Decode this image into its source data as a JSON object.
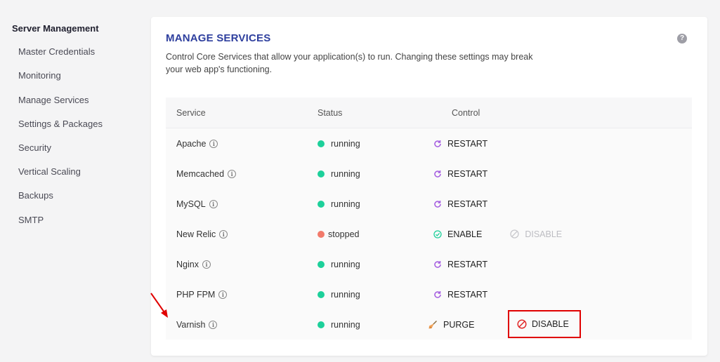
{
  "sidebar": {
    "title": "Server Management",
    "items": [
      {
        "label": "Master Credentials"
      },
      {
        "label": "Monitoring"
      },
      {
        "label": "Manage Services"
      },
      {
        "label": "Settings & Packages"
      },
      {
        "label": "Security"
      },
      {
        "label": "Vertical Scaling"
      },
      {
        "label": "Backups"
      },
      {
        "label": "SMTP"
      }
    ]
  },
  "card": {
    "title": "MANAGE SERVICES",
    "help_icon": "question-icon",
    "help_glyph": "?",
    "description": "Control Core Services that allow your application(s) to run. Changing these settings may break your web app's functioning."
  },
  "table": {
    "headers": {
      "service": "Service",
      "status": "Status",
      "control": "Control"
    },
    "info_glyph": "i",
    "rows": [
      {
        "service": "Apache",
        "status": "running",
        "action": "RESTART"
      },
      {
        "service": "Memcached",
        "status": "running",
        "action": "RESTART"
      },
      {
        "service": "MySQL",
        "status": "running",
        "action": "RESTART"
      },
      {
        "service": "New Relic",
        "status": "stopped",
        "action": "ENABLE",
        "secondary": "DISABLE"
      },
      {
        "service": "Nginx",
        "status": "running",
        "action": "RESTART"
      },
      {
        "service": "PHP FPM",
        "status": "running",
        "action": "RESTART"
      },
      {
        "service": "Varnish",
        "status": "running",
        "action": "PURGE",
        "secondary": "DISABLE"
      }
    ]
  },
  "colors": {
    "title": "#2e3f9e",
    "running": "#1dd09a",
    "stopped": "#f27a6b",
    "restart_icon": "#a45de0",
    "enable_icon": "#1dd09a",
    "highlight": "#e00000"
  }
}
